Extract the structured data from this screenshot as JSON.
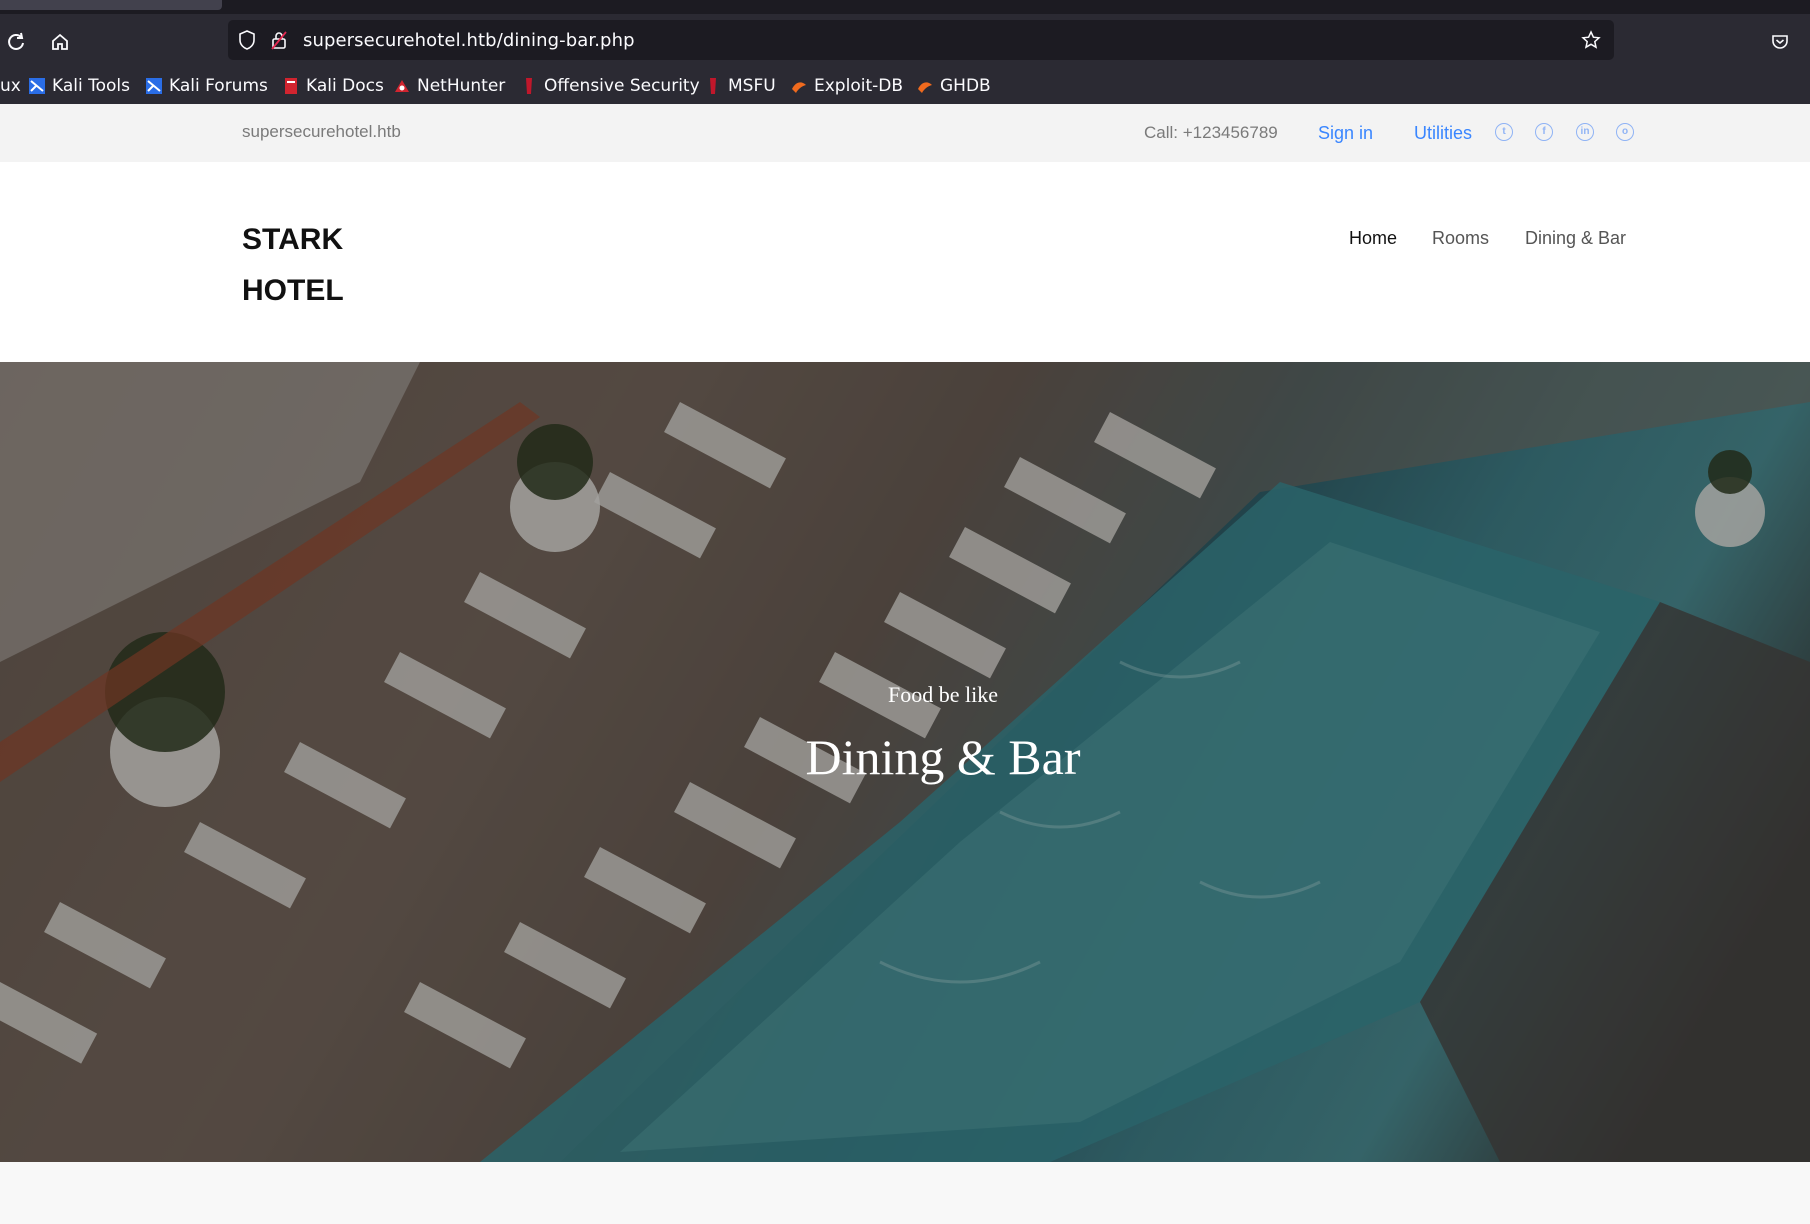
{
  "browser": {
    "url": "supersecurehotel.htb/dining-bar.php",
    "bookmarks": [
      {
        "label": "ux",
        "icon": "kali-icon",
        "color": "#2a6de6"
      },
      {
        "label": "Kali Tools",
        "icon": "kali-icon",
        "color": "#2a6de6"
      },
      {
        "label": "Kali Forums",
        "icon": "kali-icon",
        "color": "#2a6de6"
      },
      {
        "label": "Kali Docs",
        "icon": "docs-icon",
        "color": "#d1242f"
      },
      {
        "label": "NetHunter",
        "icon": "nethunter-icon",
        "color": "#d1242f"
      },
      {
        "label": "Offensive Security",
        "icon": "offsec-icon",
        "color": "#c0172b"
      },
      {
        "label": "MSFU",
        "icon": "offsec-icon",
        "color": "#c0172b"
      },
      {
        "label": "Exploit-DB",
        "icon": "exploitdb-icon",
        "color": "#f06a1e"
      },
      {
        "label": "GHDB",
        "icon": "exploitdb-icon",
        "color": "#f06a1e"
      }
    ]
  },
  "topbar": {
    "domain": "supersecurehotel.htb",
    "phone": "Call: +123456789",
    "sign_in": "Sign in",
    "utilities": "Utilities",
    "social_icons": [
      "twitter-icon",
      "facebook-icon",
      "linkedin-icon",
      "instagram-icon"
    ],
    "link_color": "#3a86ff"
  },
  "header": {
    "logo_line1": "STARK",
    "logo_line2": "HOTEL",
    "menu": [
      "Home",
      "Rooms",
      "Dining & Bar"
    ],
    "active_menu": "Home"
  },
  "hero": {
    "subtitle": "Food be like",
    "title": "Dining & Bar"
  }
}
